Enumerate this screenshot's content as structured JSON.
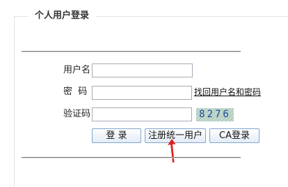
{
  "login_box": {
    "title": "个人用户登录"
  },
  "form": {
    "username_label": "用户名",
    "password_label": "密  码",
    "captcha_label": "验证码",
    "username_value": "",
    "password_value": "",
    "captcha_value": "",
    "recover_link": "找回用户名和密码",
    "captcha_code": "8276"
  },
  "buttons": {
    "login": "登 录",
    "register": "注册统一用户",
    "ca_login": "CA登录"
  },
  "colors": {
    "annotation_arrow": "#e02020",
    "button_border": "#7fa4cf",
    "captcha_bg": "#b9d3c4"
  }
}
